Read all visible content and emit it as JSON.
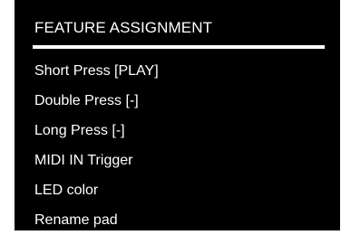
{
  "title": "FEATURE ASSIGNMENT",
  "menu": {
    "items": [
      {
        "label": "Short Press [PLAY]"
      },
      {
        "label": "Double Press [-]"
      },
      {
        "label": "Long Press [-]"
      },
      {
        "label": "MIDI IN Trigger"
      },
      {
        "label": "LED color"
      },
      {
        "label": "Rename pad"
      }
    ]
  },
  "colors": {
    "background": "#000000",
    "text": "#ffffff",
    "divider": "#ffffff"
  }
}
